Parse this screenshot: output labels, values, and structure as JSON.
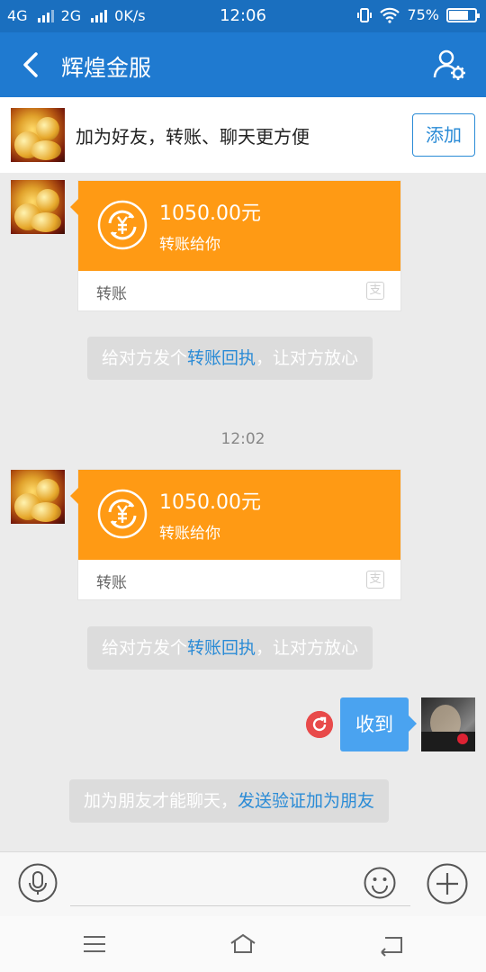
{
  "status_bar": {
    "network1": "4G",
    "network2": "2G",
    "speed": "0K/s",
    "time": "12:06",
    "battery": "75%",
    "battery_level": 0.75
  },
  "app_bar": {
    "title": "辉煌金服"
  },
  "add_banner": {
    "text": "加为好友，转账、聊天更方便",
    "button": "添加"
  },
  "messages": [
    {
      "amount": "1050.00元",
      "subtitle": "转账给你",
      "footer": "转账",
      "badge": "支"
    },
    {
      "amount": "1050.00元",
      "subtitle": "转账给你",
      "footer": "转账",
      "badge": "支"
    }
  ],
  "receipt_notice": {
    "before": "给对方发个",
    "link": "转账回执",
    "after": "，让对方放心"
  },
  "timestamp": "12:02",
  "reply": {
    "text": "收到"
  },
  "friend_notice": {
    "before": "加为朋友才能聊天，",
    "link": "发送验证加为朋友"
  },
  "colors": {
    "app_bar": "#1f7ad0",
    "transfer_card": "#ff9a14",
    "link": "#2a8bd6",
    "my_bubble": "#4aa3f0",
    "resend": "#e84a4a"
  }
}
